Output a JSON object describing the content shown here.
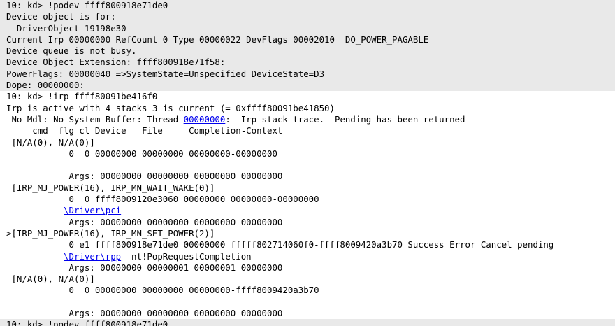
{
  "command_blocks": [
    {
      "lines": [
        "10: kd> !podev ffff800918e71de0",
        "Device object is for:",
        "  DriverObject 19198e30",
        "Current Irp 00000000 RefCount 0 Type 00000022 DevFlags 00002010  DO_POWER_PAGABLE",
        "Device queue is not busy.",
        "Device Object Extension: ffff800918e71f58:",
        "PowerFlags: 00000040 =>SystemState=Unspecified DeviceState=D3",
        "Dope: 00000000:"
      ]
    },
    {
      "lines": [
        "10: kd> !irp ffff80091be416f0",
        "Irp is active with 4 stacks 3 is current (= 0xffff80091be41850)",
        {
          "segments": [
            " No Mdl: No System Buffer: Thread ",
            {
              "link": "00000000"
            },
            ":  Irp stack trace.  Pending has been returned"
          ]
        },
        "     cmd  flg cl Device   File     Completion-Context",
        " [N/A(0), N/A(0)]",
        "            0  0 00000000 00000000 00000000-00000000",
        "",
        "            Args: 00000000 00000000 00000000 00000000",
        " [IRP_MJ_POWER(16), IRP_MN_WAIT_WAKE(0)]",
        "            0  0 ffff8009120e3060 00000000 00000000-00000000",
        {
          "segments": [
            "           ",
            {
              "link": "\\Driver\\pci"
            }
          ]
        },
        "            Args: 00000000 00000000 00000000 00000000",
        ">[IRP_MJ_POWER(16), IRP_MN_SET_POWER(2)]",
        "            0 e1 ffff800918e71de0 00000000 fffff802714060f0-ffff8009420a3b70 Success Error Cancel pending",
        {
          "segments": [
            "           ",
            {
              "link": "\\Driver\\rpp"
            },
            "  nt!PopRequestCompletion"
          ]
        },
        "            Args: 00000000 00000001 00000001 00000000",
        " [N/A(0), N/A(0)]",
        "            0  0 00000000 00000000 00000000-ffff8009420a3b70",
        "",
        "            Args: 00000000 00000000 00000000 00000000"
      ]
    },
    {
      "lines": [
        "10: kd> !podev ffff800918e71de0"
      ]
    }
  ]
}
